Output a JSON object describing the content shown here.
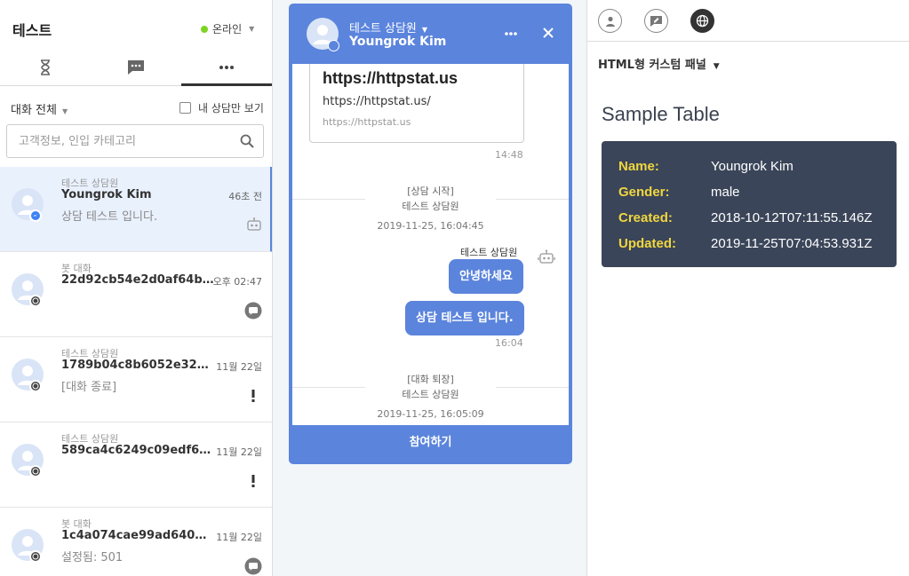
{
  "left": {
    "title": "테스트",
    "status": "온라인",
    "filter_label": "대화 전체",
    "mine_label": "내 상담만 보기",
    "search_placeholder": "고객정보, 인입 카테고리",
    "conversations": [
      {
        "sub": "테스트 상담원",
        "name": "Youngrok Kim",
        "time": "46초 전",
        "preview": "상담 테스트 입니다.",
        "channel": "messenger-icon",
        "right_icon": "robot-icon"
      },
      {
        "sub": "봇 대화",
        "name": "22d92cb54e2d0af64b3...",
        "time": "오후 02:47",
        "preview": "",
        "channel": "web-icon",
        "right_icon": "chat-bubble-icon"
      },
      {
        "sub": "테스트 상담원",
        "name": "1789b04c8b6052e32df...",
        "time": "11월 22일",
        "preview": "[대화 종료]",
        "channel": "web-icon",
        "right_icon": "alert-icon"
      },
      {
        "sub": "테스트 상담원",
        "name": "589ca4c6249c09edf6d6...",
        "time": "11월 22일",
        "preview": "",
        "channel": "web-icon",
        "right_icon": "alert-icon"
      },
      {
        "sub": "봇 대화",
        "name": "1c4a074cae99ad640ec...",
        "time": "11월 22일",
        "preview": "설정됨: 501",
        "channel": "web-icon",
        "right_icon": "chat-bubble-icon"
      }
    ]
  },
  "chat": {
    "agent": "테스트 상담원",
    "customer": "Youngrok Kim",
    "link_card": {
      "title": "https://httpstat.us",
      "url": "https://httpstat.us/",
      "host": "https://httpstat.us"
    },
    "link_time": "14:48",
    "start_event": {
      "label": "[상담 시작]",
      "who": "테스트 상담원",
      "when": "2019-11-25, 16:04:45"
    },
    "sender": "테스트 상담원",
    "bubbles": [
      "안녕하세요",
      "상담 테스트 입니다."
    ],
    "bubble_time": "16:04",
    "end_event": {
      "label": "[대화 퇴장]",
      "who": "테스트 상담원",
      "when": "2019-11-25, 16:05:09"
    },
    "join_label": "참여하기"
  },
  "right": {
    "panel_name": "HTML형 커스텀 패널",
    "heading": "Sample Table",
    "rows": [
      {
        "key": "Name:",
        "value": "Youngrok Kim"
      },
      {
        "key": "Gender:",
        "value": "male"
      },
      {
        "key": "Created:",
        "value": "2018-10-12T07:11:55.146Z"
      },
      {
        "key": "Updated:",
        "value": "2019-11-25T07:04:53.931Z"
      }
    ]
  },
  "colors": {
    "accent": "#5b84dc",
    "online": "#7ed321",
    "table_bg": "#3a4559",
    "table_key": "#f0d63f"
  }
}
